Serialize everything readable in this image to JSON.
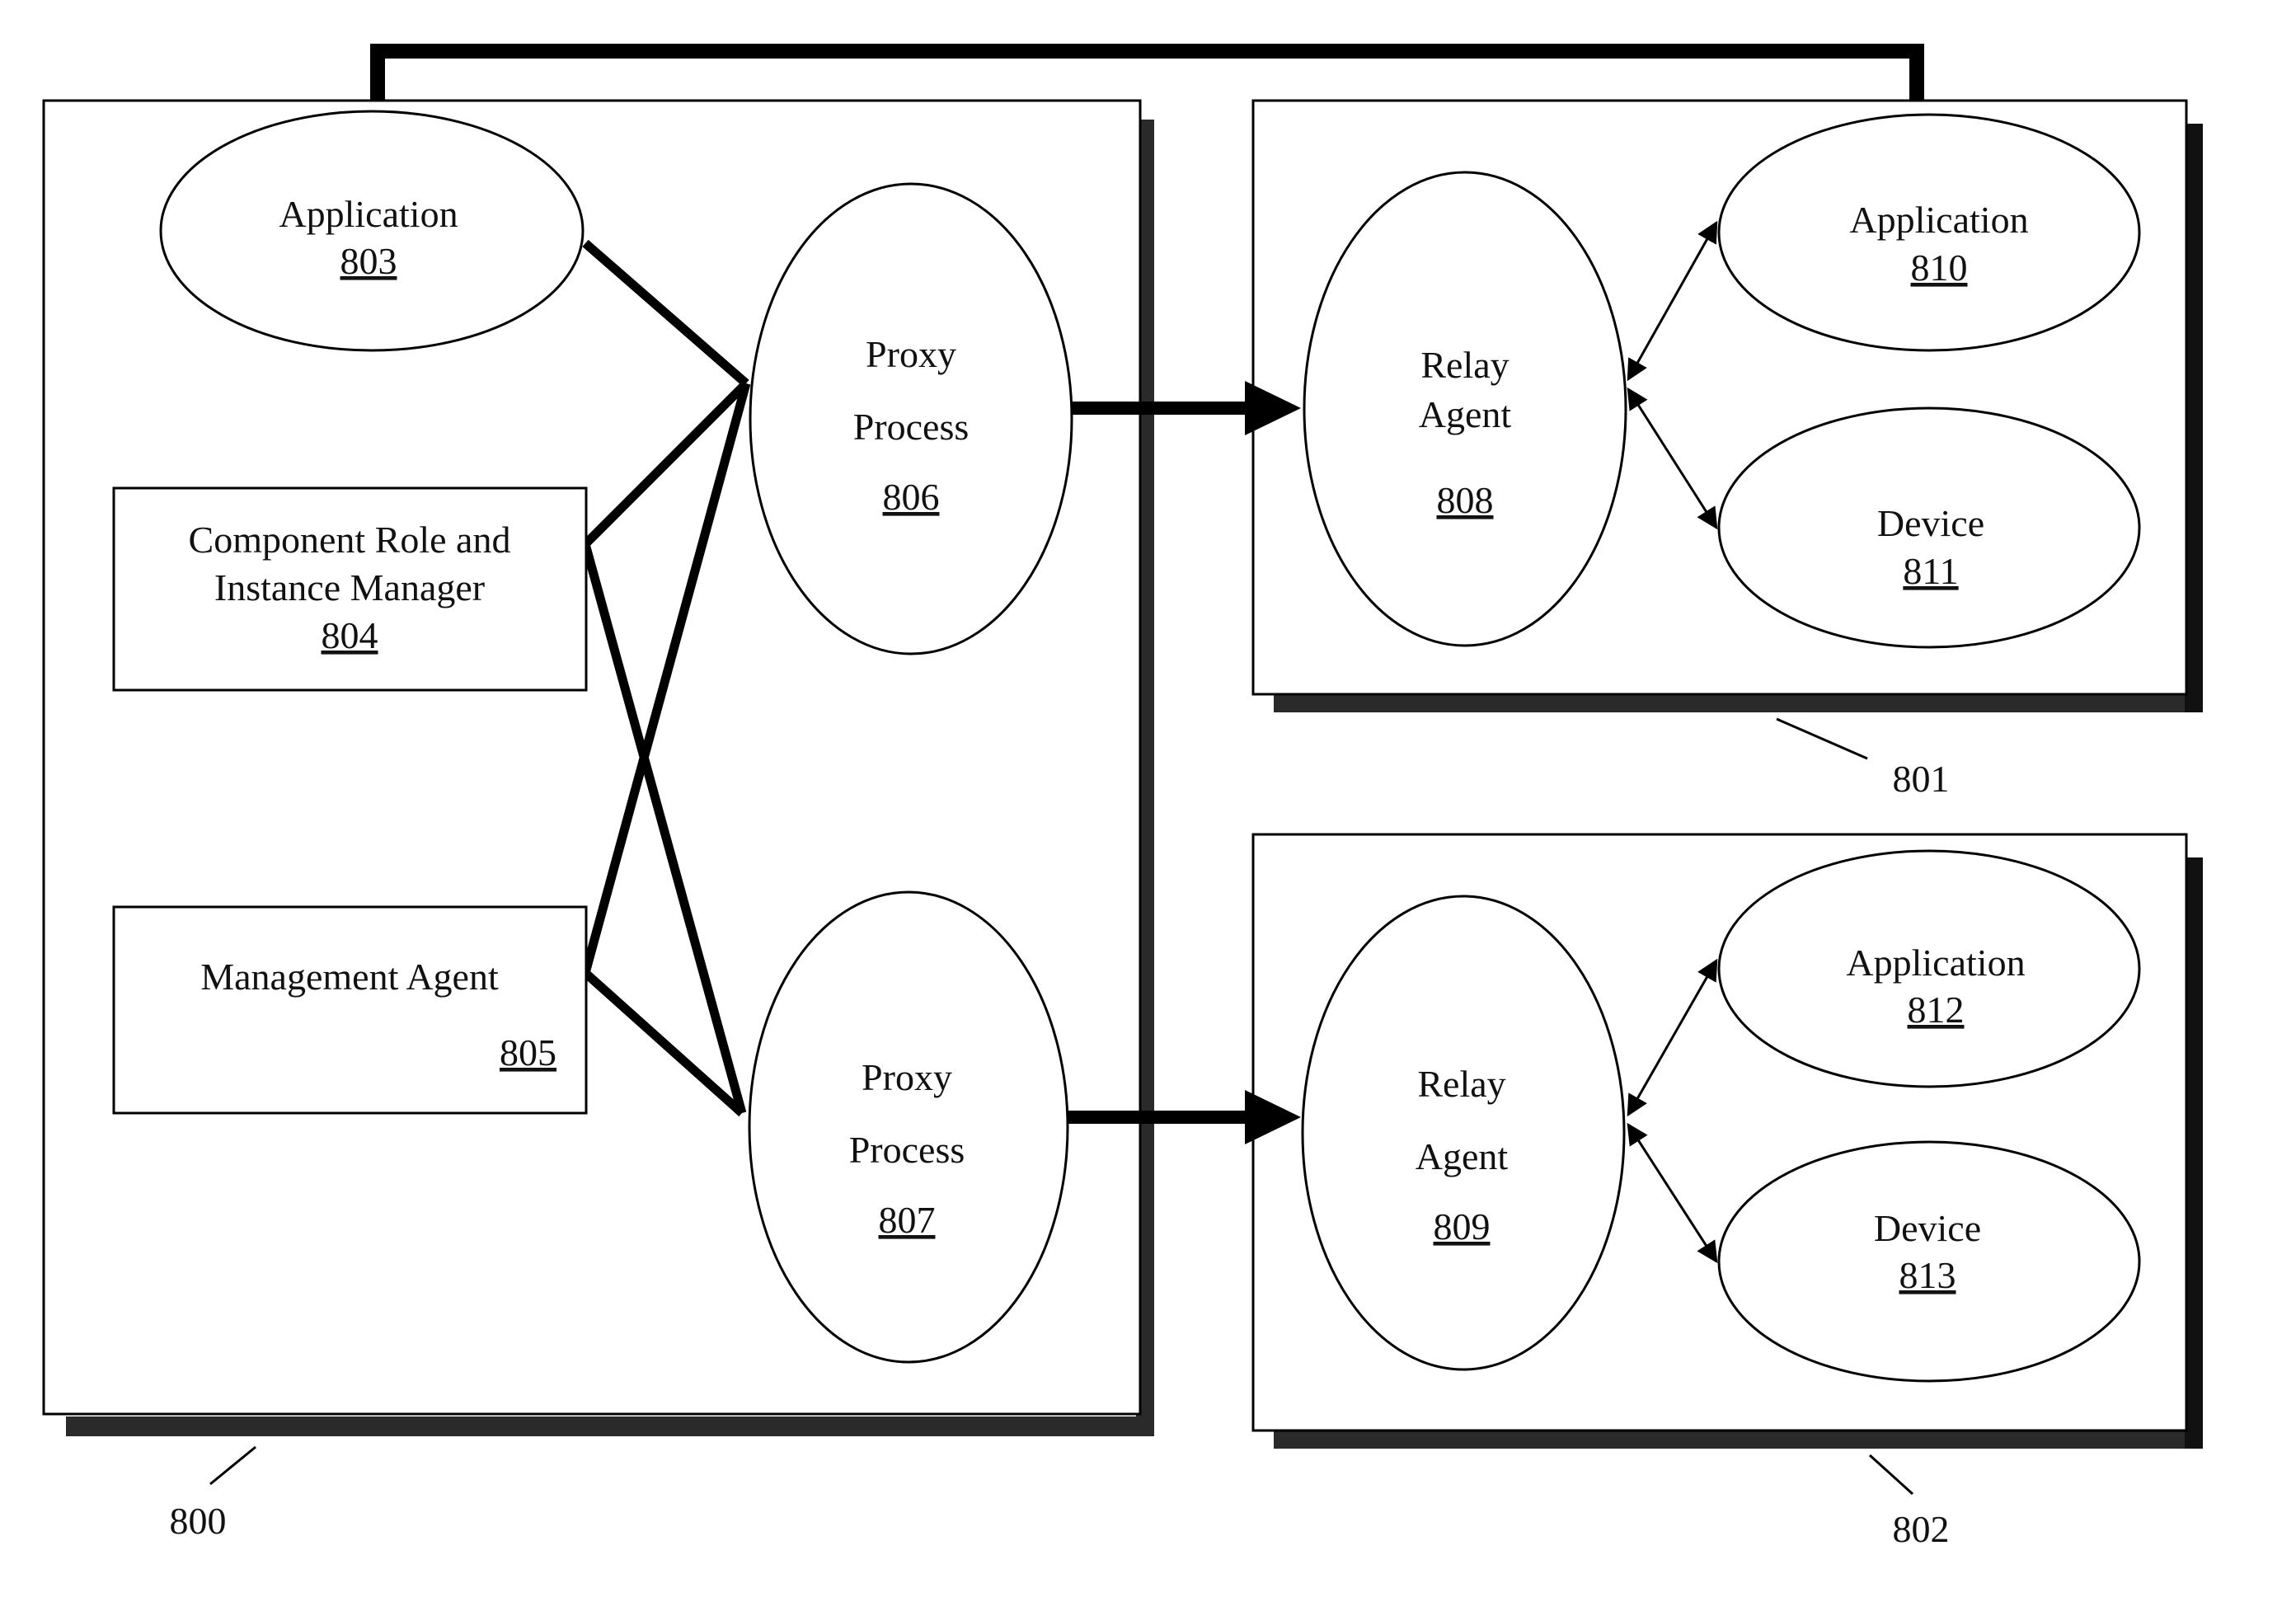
{
  "figure": {
    "connector_from": "800",
    "connector_to": "801"
  },
  "containers": {
    "c800": {
      "ref": "800"
    },
    "c801": {
      "ref": "801"
    },
    "c802": {
      "ref": "802"
    }
  },
  "nodes": {
    "app803": {
      "lines": [
        "Application"
      ],
      "num": "803"
    },
    "crim804": {
      "lines": [
        "Component Role and",
        "Instance Manager"
      ],
      "num": "804"
    },
    "ma805": {
      "lines": [
        "Management Agent"
      ],
      "num": "805"
    },
    "pp806": {
      "lines": [
        "Proxy",
        "Process"
      ],
      "num": "806"
    },
    "pp807": {
      "lines": [
        "Proxy",
        "Process"
      ],
      "num": "807"
    },
    "ra808": {
      "lines": [
        "Relay",
        "Agent"
      ],
      "num": "808"
    },
    "ra809": {
      "lines": [
        "Relay",
        "Agent"
      ],
      "num": "809"
    },
    "app810": {
      "lines": [
        "Application"
      ],
      "num": "810"
    },
    "dev811": {
      "lines": [
        "Device"
      ],
      "num": "811"
    },
    "app812": {
      "lines": [
        "Application"
      ],
      "num": "812"
    },
    "dev813": {
      "lines": [
        "Device"
      ],
      "num": "813"
    }
  },
  "edges": [
    {
      "from": "803",
      "to": "806",
      "type": "line"
    },
    {
      "from": "804",
      "to": "806",
      "type": "line"
    },
    {
      "from": "804",
      "to": "807",
      "type": "line"
    },
    {
      "from": "805",
      "to": "806",
      "type": "line"
    },
    {
      "from": "805",
      "to": "807",
      "type": "line"
    },
    {
      "from": "806",
      "to": "808",
      "type": "arrow"
    },
    {
      "from": "807",
      "to": "809",
      "type": "arrow"
    },
    {
      "from": "808",
      "to": "810",
      "type": "bidirectional"
    },
    {
      "from": "808",
      "to": "811",
      "type": "bidirectional"
    },
    {
      "from": "809",
      "to": "812",
      "type": "bidirectional"
    },
    {
      "from": "809",
      "to": "813",
      "type": "bidirectional"
    }
  ]
}
